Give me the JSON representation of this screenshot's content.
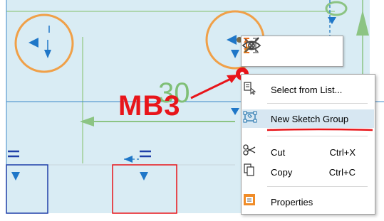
{
  "canvas": {
    "background": "#d9ecf4",
    "dimension_value": "30",
    "dimension_color": "#7fbf76",
    "annotation_label": "MB3",
    "annotation_color": "#e8151a"
  },
  "mini_toolbar": {
    "buttons": [
      {
        "name": "dimension-toggle-icon"
      },
      {
        "name": "hide-icon"
      },
      {
        "name": "paint-brush-icon"
      },
      {
        "name": "close-icon"
      }
    ]
  },
  "context_menu": {
    "items": [
      {
        "label": "Select from List...",
        "icon": "select-from-list-icon",
        "shortcut": ""
      },
      {
        "label": "New Sketch Group",
        "icon": "new-sketch-group-icon",
        "shortcut": "",
        "highlighted": true
      },
      {
        "label": "Cut",
        "icon": "scissors-icon",
        "shortcut": "Ctrl+X"
      },
      {
        "label": "Copy",
        "icon": "copy-icon",
        "shortcut": "Ctrl+C"
      },
      {
        "label": "Properties",
        "icon": "properties-icon",
        "shortcut": ""
      }
    ]
  },
  "colors": {
    "highlight": "#d7e7f2",
    "sketch_blue": "#1f77c8",
    "circle_orange": "#f0a048",
    "underline_red": "#e8151a"
  }
}
